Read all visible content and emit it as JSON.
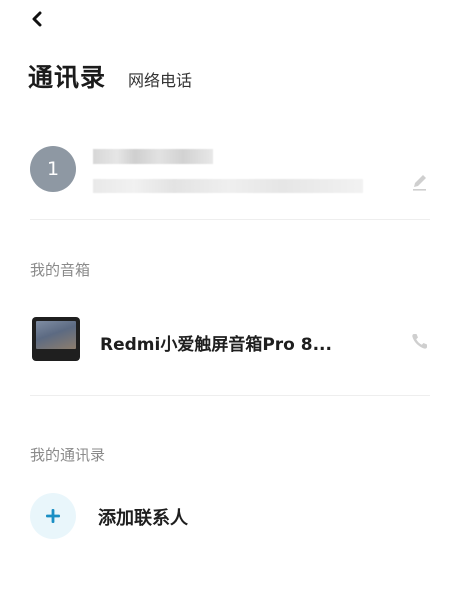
{
  "header": {
    "title": "通讯录",
    "secondary_tab": "网络电话"
  },
  "me": {
    "avatar_text": "1"
  },
  "sections": {
    "speakers_label": "我的音箱",
    "contacts_label": "我的通讯录"
  },
  "speaker": {
    "name": "Redmi小爱触屏音箱Pro 8..."
  },
  "add_contact": {
    "label": "添加联系人"
  },
  "colors": {
    "avatar_bg": "#8e98a3",
    "accent": "#1a8fc4",
    "accent_bg": "#e9f6fb"
  }
}
